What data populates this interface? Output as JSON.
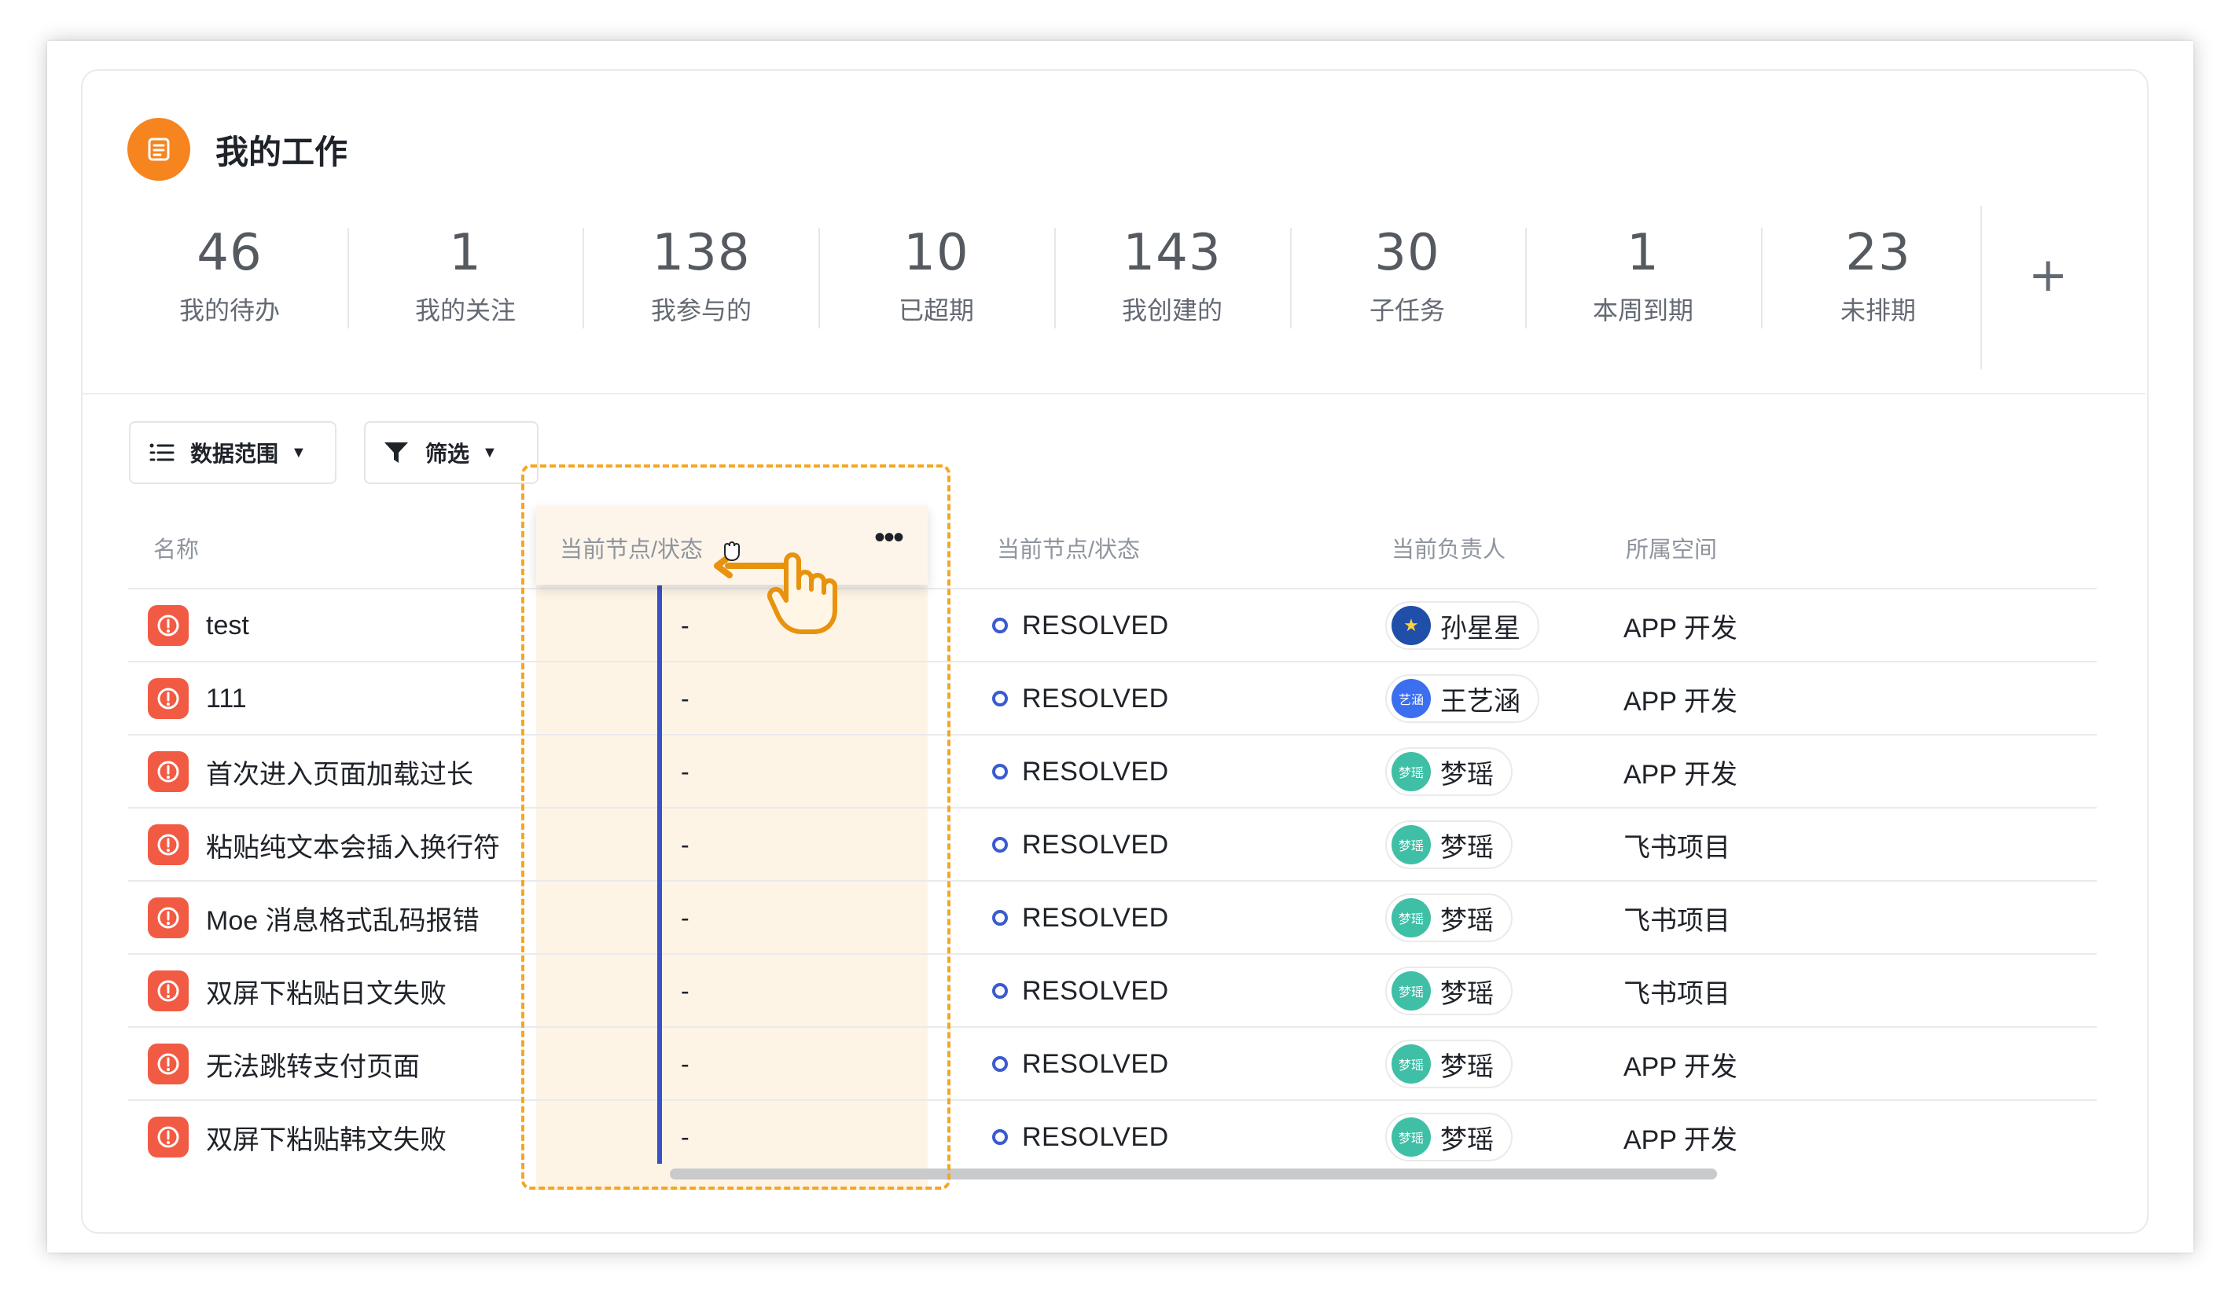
{
  "header": {
    "title": "我的工作",
    "icon": "list-doc-icon"
  },
  "stats": [
    {
      "value": "46",
      "label": "我的待办"
    },
    {
      "value": "1",
      "label": "我的关注"
    },
    {
      "value": "138",
      "label": "我参与的"
    },
    {
      "value": "10",
      "label": "已超期"
    },
    {
      "value": "143",
      "label": "我创建的"
    },
    {
      "value": "30",
      "label": "子任务"
    },
    {
      "value": "1",
      "label": "本周到期"
    },
    {
      "value": "23",
      "label": "未排期"
    }
  ],
  "add_label": "+",
  "toolbar": {
    "scope_label": "数据范围",
    "filter_label": "筛选"
  },
  "columns": {
    "name": "名称",
    "dragging": "当前节点/状态",
    "status": "当前节点/状态",
    "owner": "当前负责人",
    "space": "所属空间"
  },
  "more_label": "•••",
  "rows": [
    {
      "name": "test",
      "placeholder": "-",
      "status": "RESOLVED",
      "owner": "孙星星",
      "avatar_text": "★",
      "avatar_color": "#1f4fa8",
      "space": "APP 开发"
    },
    {
      "name": "111",
      "placeholder": "-",
      "status": "RESOLVED",
      "owner": "王艺涵",
      "avatar_text": "艺涵",
      "avatar_color": "#3b6ff0",
      "space": "APP 开发"
    },
    {
      "name": "首次进入页面加载过长",
      "placeholder": "-",
      "status": "RESOLVED",
      "owner": "梦瑶",
      "avatar_text": "梦瑶",
      "avatar_color": "#3fbfa6",
      "space": "APP 开发"
    },
    {
      "name": "粘贴纯文本会插入换行符",
      "placeholder": "-",
      "status": "RESOLVED",
      "owner": "梦瑶",
      "avatar_text": "梦瑶",
      "avatar_color": "#3fbfa6",
      "space": "飞书项目"
    },
    {
      "name": "Moe 消息格式乱码报错",
      "placeholder": "-",
      "status": "RESOLVED",
      "owner": "梦瑶",
      "avatar_text": "梦瑶",
      "avatar_color": "#3fbfa6",
      "space": "飞书项目"
    },
    {
      "name": "双屏下粘贴日文失败",
      "placeholder": "-",
      "status": "RESOLVED",
      "owner": "梦瑶",
      "avatar_text": "梦瑶",
      "avatar_color": "#3fbfa6",
      "space": "飞书项目"
    },
    {
      "name": "无法跳转支付页面",
      "placeholder": "-",
      "status": "RESOLVED",
      "owner": "梦瑶",
      "avatar_text": "梦瑶",
      "avatar_color": "#3fbfa6",
      "space": "APP 开发"
    },
    {
      "name": "双屏下粘贴韩文失败",
      "placeholder": "-",
      "status": "RESOLVED",
      "owner": "梦瑶",
      "avatar_text": "梦瑶",
      "avatar_color": "#3fbfa6",
      "space": "APP 开发"
    }
  ],
  "colors": {
    "accent": "#f6841f",
    "alert": "#f25b43",
    "status_ring": "#3a5bd0",
    "drop_indicator": "#3d4fc6",
    "drag_outline": "#f5a623"
  },
  "icons": {
    "scope": "list-indent-icon",
    "filter": "funnel-icon",
    "row": "alert-circle-icon",
    "status": "circle-outline-icon",
    "cursor": "grab-hand-cursor-icon"
  }
}
